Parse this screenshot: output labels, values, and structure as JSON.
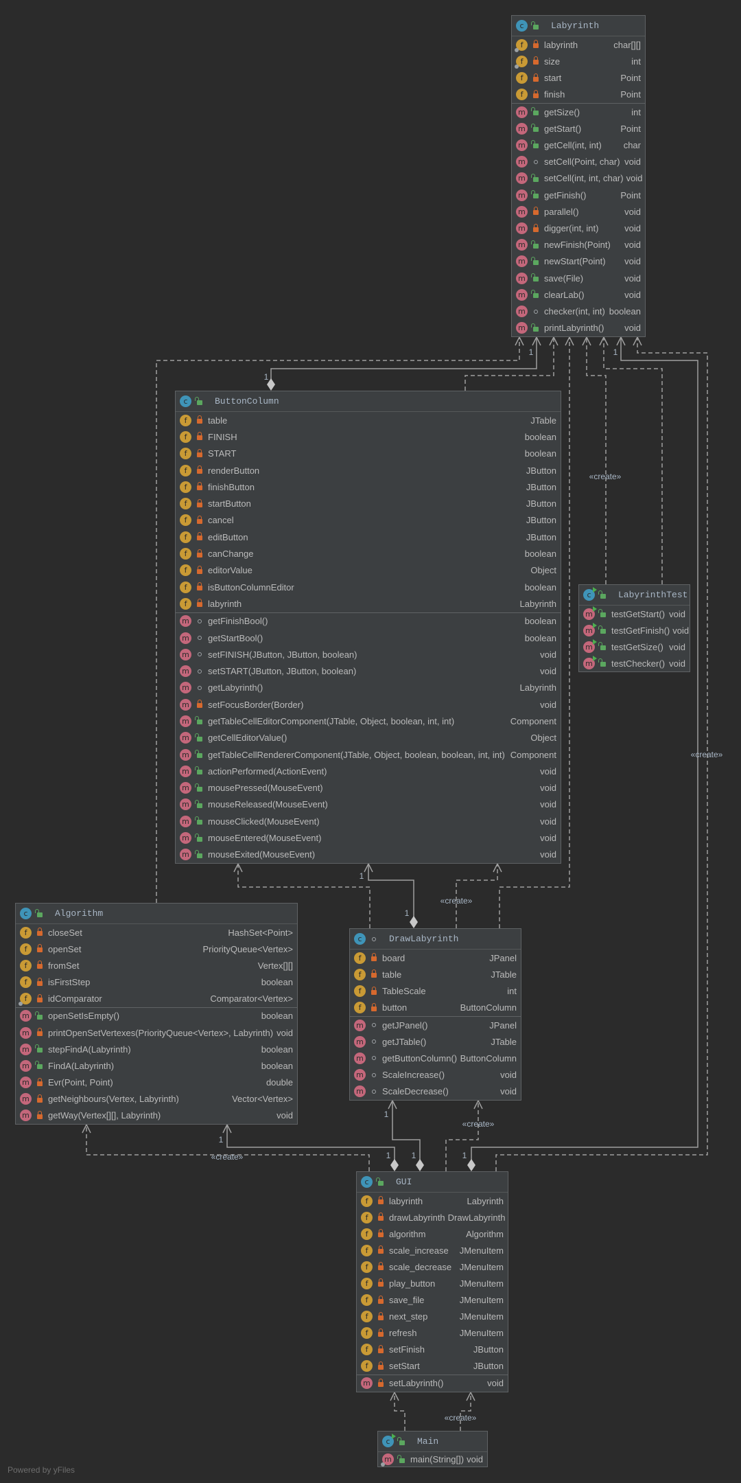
{
  "classes": [
    {
      "id": "Labyrinth",
      "name": "Labyrinth",
      "kind": "class",
      "visibility": "public",
      "fields": [
        {
          "name": "labyrinth",
          "type": "char[][]",
          "vis": "private",
          "static": true
        },
        {
          "name": "size",
          "type": "int",
          "vis": "private",
          "static": true
        },
        {
          "name": "start",
          "type": "Point",
          "vis": "private"
        },
        {
          "name": "finish",
          "type": "Point",
          "vis": "private"
        }
      ],
      "methods": [
        {
          "name": "getSize()",
          "type": "int",
          "vis": "public"
        },
        {
          "name": "getStart()",
          "type": "Point",
          "vis": "public"
        },
        {
          "name": "getCell(int, int)",
          "type": "char",
          "vis": "public"
        },
        {
          "name": "setCell(Point, char)",
          "type": "void",
          "vis": "package"
        },
        {
          "name": "setCell(int, int, char)",
          "type": "void",
          "vis": "public"
        },
        {
          "name": "getFinish()",
          "type": "Point",
          "vis": "public"
        },
        {
          "name": "parallel()",
          "type": "void",
          "vis": "private"
        },
        {
          "name": "digger(int, int)",
          "type": "void",
          "vis": "private"
        },
        {
          "name": "newFinish(Point)",
          "type": "void",
          "vis": "public"
        },
        {
          "name": "newStart(Point)",
          "type": "void",
          "vis": "public"
        },
        {
          "name": "save(File)",
          "type": "void",
          "vis": "public"
        },
        {
          "name": "clearLab()",
          "type": "void",
          "vis": "public"
        },
        {
          "name": "checker(int, int)",
          "type": "boolean",
          "vis": "package"
        },
        {
          "name": "printLabyrinth()",
          "type": "void",
          "vis": "public"
        }
      ]
    },
    {
      "id": "ButtonColumn",
      "name": "ButtonColumn",
      "kind": "class",
      "visibility": "public",
      "fields": [
        {
          "name": "table",
          "type": "JTable",
          "vis": "private"
        },
        {
          "name": "FINISH",
          "type": "boolean",
          "vis": "private"
        },
        {
          "name": "START",
          "type": "boolean",
          "vis": "private"
        },
        {
          "name": "renderButton",
          "type": "JButton",
          "vis": "private"
        },
        {
          "name": "finishButton",
          "type": "JButton",
          "vis": "private"
        },
        {
          "name": "startButton",
          "type": "JButton",
          "vis": "private"
        },
        {
          "name": "cancel",
          "type": "JButton",
          "vis": "private"
        },
        {
          "name": "editButton",
          "type": "JButton",
          "vis": "private"
        },
        {
          "name": "canChange",
          "type": "boolean",
          "vis": "private"
        },
        {
          "name": "editorValue",
          "type": "Object",
          "vis": "private"
        },
        {
          "name": "isButtonColumnEditor",
          "type": "boolean",
          "vis": "private"
        },
        {
          "name": "labyrinth",
          "type": "Labyrinth",
          "vis": "private"
        }
      ],
      "methods": [
        {
          "name": "getFinishBool()",
          "type": "boolean",
          "vis": "package"
        },
        {
          "name": "getStartBool()",
          "type": "boolean",
          "vis": "package"
        },
        {
          "name": "setFINISH(JButton, JButton, boolean)",
          "type": "void",
          "vis": "package"
        },
        {
          "name": "setSTART(JButton, JButton, boolean)",
          "type": "void",
          "vis": "package"
        },
        {
          "name": "getLabyrinth()",
          "type": "Labyrinth",
          "vis": "package"
        },
        {
          "name": "setFocusBorder(Border)",
          "type": "void",
          "vis": "private"
        },
        {
          "name": "getTableCellEditorComponent(JTable, Object, boolean, int, int)",
          "type": "Component",
          "vis": "public"
        },
        {
          "name": "getCellEditorValue()",
          "type": "Object",
          "vis": "public"
        },
        {
          "name": "getTableCellRendererComponent(JTable, Object, boolean, boolean, int, int)",
          "type": "Component",
          "vis": "public"
        },
        {
          "name": "actionPerformed(ActionEvent)",
          "type": "void",
          "vis": "public"
        },
        {
          "name": "mousePressed(MouseEvent)",
          "type": "void",
          "vis": "public"
        },
        {
          "name": "mouseReleased(MouseEvent)",
          "type": "void",
          "vis": "public"
        },
        {
          "name": "mouseClicked(MouseEvent)",
          "type": "void",
          "vis": "public"
        },
        {
          "name": "mouseEntered(MouseEvent)",
          "type": "void",
          "vis": "public"
        },
        {
          "name": "mouseExited(MouseEvent)",
          "type": "void",
          "vis": "public"
        }
      ]
    },
    {
      "id": "LabyrinthTest",
      "name": "LabyrinthTest",
      "kind": "test",
      "visibility": "public",
      "fields": [],
      "methods": [
        {
          "name": "testGetStart()",
          "type": "void",
          "vis": "public",
          "test": true
        },
        {
          "name": "testGetFinish()",
          "type": "void",
          "vis": "public",
          "test": true
        },
        {
          "name": "testGetSize()",
          "type": "void",
          "vis": "public",
          "test": true
        },
        {
          "name": "testChecker()",
          "type": "void",
          "vis": "public",
          "test": true
        }
      ]
    },
    {
      "id": "Algorithm",
      "name": "Algorithm",
      "kind": "class",
      "visibility": "public",
      "fields": [
        {
          "name": "closeSet",
          "type": "HashSet<Point>",
          "vis": "private"
        },
        {
          "name": "openSet",
          "type": "PriorityQueue<Vertex>",
          "vis": "private"
        },
        {
          "name": "fromSet",
          "type": "Vertex[][]",
          "vis": "private"
        },
        {
          "name": "isFirstStep",
          "type": "boolean",
          "vis": "private"
        },
        {
          "name": "idComparator",
          "type": "Comparator<Vertex>",
          "vis": "private",
          "static": true
        }
      ],
      "methods": [
        {
          "name": "openSetIsEmpty()",
          "type": "boolean",
          "vis": "public"
        },
        {
          "name": "printOpenSetVertexes(PriorityQueue<Vertex>, Labyrinth)",
          "type": "void",
          "vis": "private"
        },
        {
          "name": "stepFindA(Labyrinth)",
          "type": "boolean",
          "vis": "public"
        },
        {
          "name": "FindA(Labyrinth)",
          "type": "boolean",
          "vis": "public"
        },
        {
          "name": "Evr(Point, Point)",
          "type": "double",
          "vis": "private"
        },
        {
          "name": "getNeighbours(Vertex, Labyrinth)",
          "type": "Vector<Vertex>",
          "vis": "private"
        },
        {
          "name": "getWay(Vertex[][], Labyrinth)",
          "type": "void",
          "vis": "private"
        }
      ]
    },
    {
      "id": "DrawLabyrinth",
      "name": "DrawLabyrinth",
      "kind": "class",
      "visibility": "package",
      "fields": [
        {
          "name": "board",
          "type": "JPanel",
          "vis": "private"
        },
        {
          "name": "table",
          "type": "JTable",
          "vis": "private"
        },
        {
          "name": "TableScale",
          "type": "int",
          "vis": "private"
        },
        {
          "name": "button",
          "type": "ButtonColumn",
          "vis": "private"
        }
      ],
      "methods": [
        {
          "name": "getJPanel()",
          "type": "JPanel",
          "vis": "package"
        },
        {
          "name": "getJTable()",
          "type": "JTable",
          "vis": "package"
        },
        {
          "name": "getButtonColumn()",
          "type": "ButtonColumn",
          "vis": "package"
        },
        {
          "name": "ScaleIncrease()",
          "type": "void",
          "vis": "package"
        },
        {
          "name": "ScaleDecrease()",
          "type": "void",
          "vis": "package"
        }
      ]
    },
    {
      "id": "GUI",
      "name": "GUI",
      "kind": "class",
      "visibility": "public",
      "fields": [
        {
          "name": "labyrinth",
          "type": "Labyrinth",
          "vis": "private"
        },
        {
          "name": "drawLabyrinth",
          "type": "DrawLabyrinth",
          "vis": "private"
        },
        {
          "name": "algorithm",
          "type": "Algorithm",
          "vis": "private"
        },
        {
          "name": "scale_increase",
          "type": "JMenuItem",
          "vis": "private"
        },
        {
          "name": "scale_decrease",
          "type": "JMenuItem",
          "vis": "private"
        },
        {
          "name": "play_button",
          "type": "JMenuItem",
          "vis": "private"
        },
        {
          "name": "save_file",
          "type": "JMenuItem",
          "vis": "private"
        },
        {
          "name": "next_step",
          "type": "JMenuItem",
          "vis": "private"
        },
        {
          "name": "refresh",
          "type": "JMenuItem",
          "vis": "private"
        },
        {
          "name": "setFinish",
          "type": "JButton",
          "vis": "private"
        },
        {
          "name": "setStart",
          "type": "JButton",
          "vis": "private"
        }
      ],
      "methods": [
        {
          "name": "setLabyrinth()",
          "type": "void",
          "vis": "private"
        }
      ]
    },
    {
      "id": "Main",
      "name": "Main",
      "kind": "runnable",
      "visibility": "public",
      "fields": [],
      "methods": [
        {
          "name": "main(String[])",
          "type": "void",
          "vis": "public",
          "static": true
        }
      ]
    }
  ],
  "connector_labels": {
    "multiplicity": "1",
    "create": "«create»"
  },
  "footer": "Powered by yFiles",
  "colors": {
    "background": "#2b2b2b",
    "box": "#3c3f41",
    "border": "#5f6264",
    "text": "#bbbbbb",
    "class_icon": "#3f94b8",
    "field_icon": "#c99a35",
    "method_icon": "#c4677b",
    "private": "#d6692e",
    "public": "#5ba75f",
    "line": "#a0a0a0"
  }
}
